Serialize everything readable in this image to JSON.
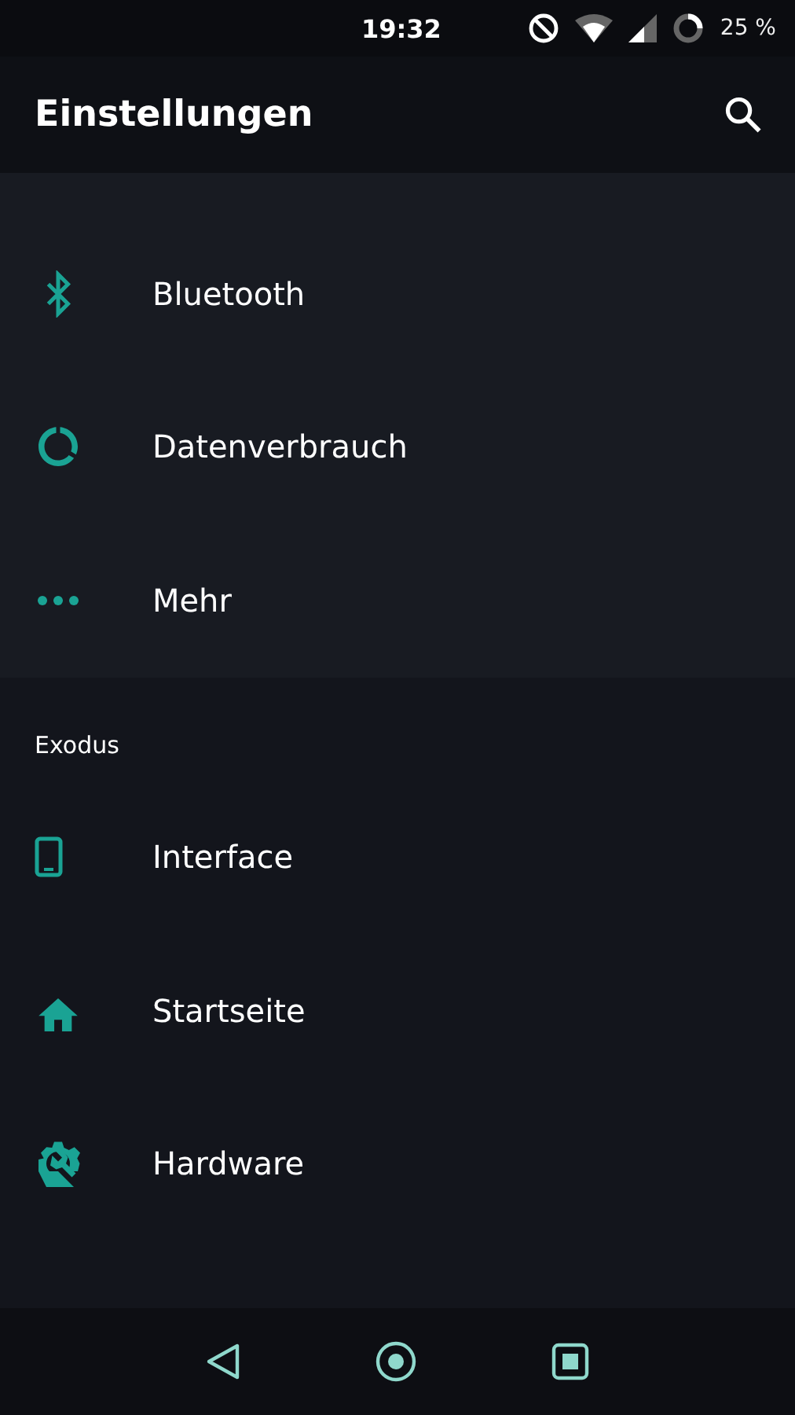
{
  "status_bar": {
    "time": "19:32",
    "battery": "25 %"
  },
  "app_bar": {
    "title": "Einstellungen"
  },
  "sections": [
    {
      "items": [
        {
          "kind": "bluetooth",
          "label": "Bluetooth"
        },
        {
          "kind": "data",
          "label": "Datenverbrauch"
        },
        {
          "kind": "more",
          "label": "Mehr"
        }
      ]
    },
    {
      "header": "Exodus",
      "items": [
        {
          "kind": "phone",
          "label": "Interface"
        },
        {
          "kind": "home",
          "label": "Startseite"
        },
        {
          "kind": "hardware",
          "label": "Hardware"
        }
      ]
    }
  ]
}
